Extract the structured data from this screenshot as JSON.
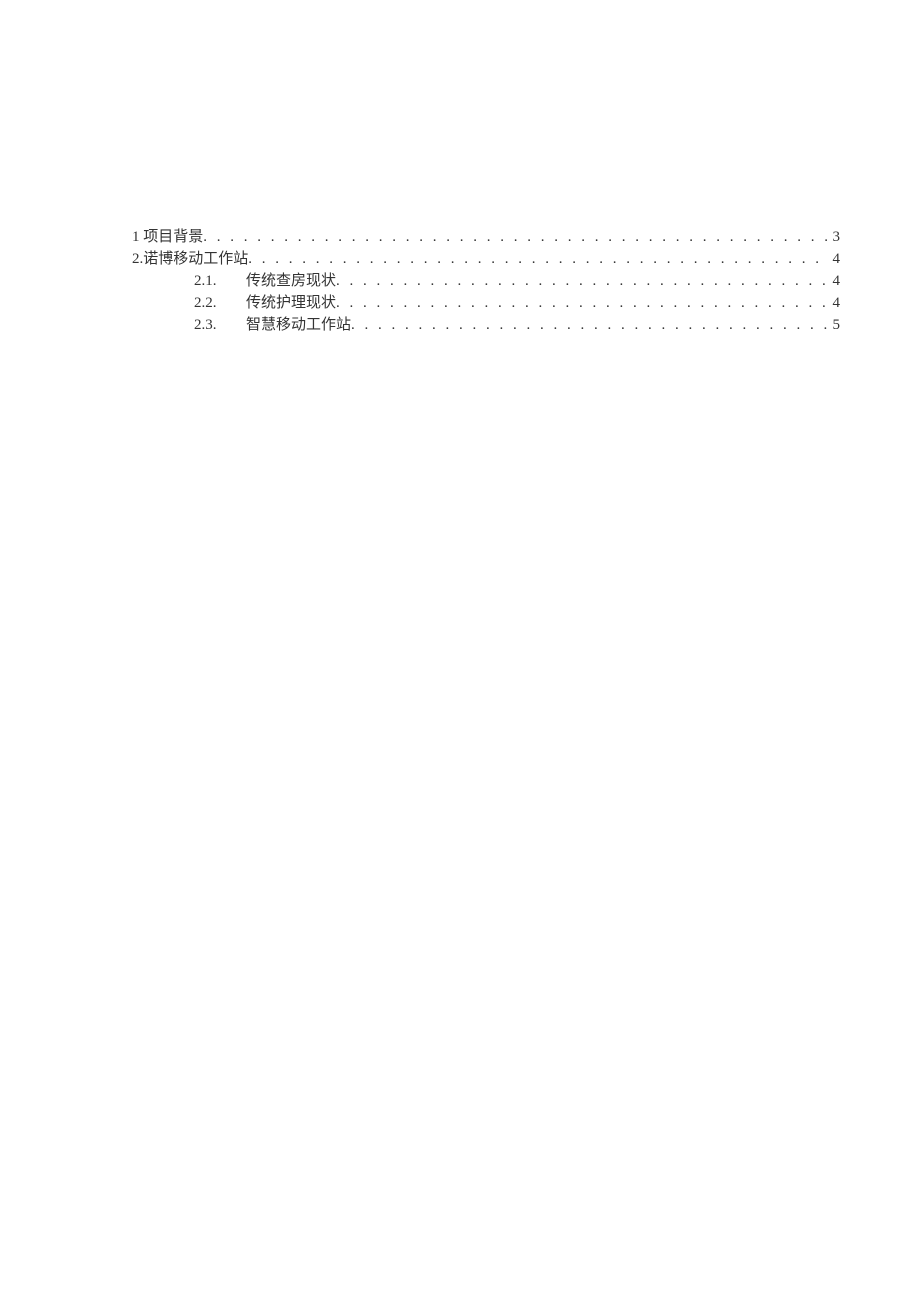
{
  "toc": {
    "entries": [
      {
        "level": 1,
        "num": "1",
        "label": "项目背景",
        "page": "3"
      },
      {
        "level": 1,
        "num": "2.",
        "label": "诺博移动工作站",
        "page": "4"
      },
      {
        "level": 2,
        "num": "2.1.",
        "label": "传统查房现状",
        "page": "4"
      },
      {
        "level": 2,
        "num": "2.2.",
        "label": "传统护理现状",
        "page": "4"
      },
      {
        "level": 2,
        "num": "2.3.",
        "label": "智慧移动工作站",
        "page": "5"
      }
    ]
  }
}
